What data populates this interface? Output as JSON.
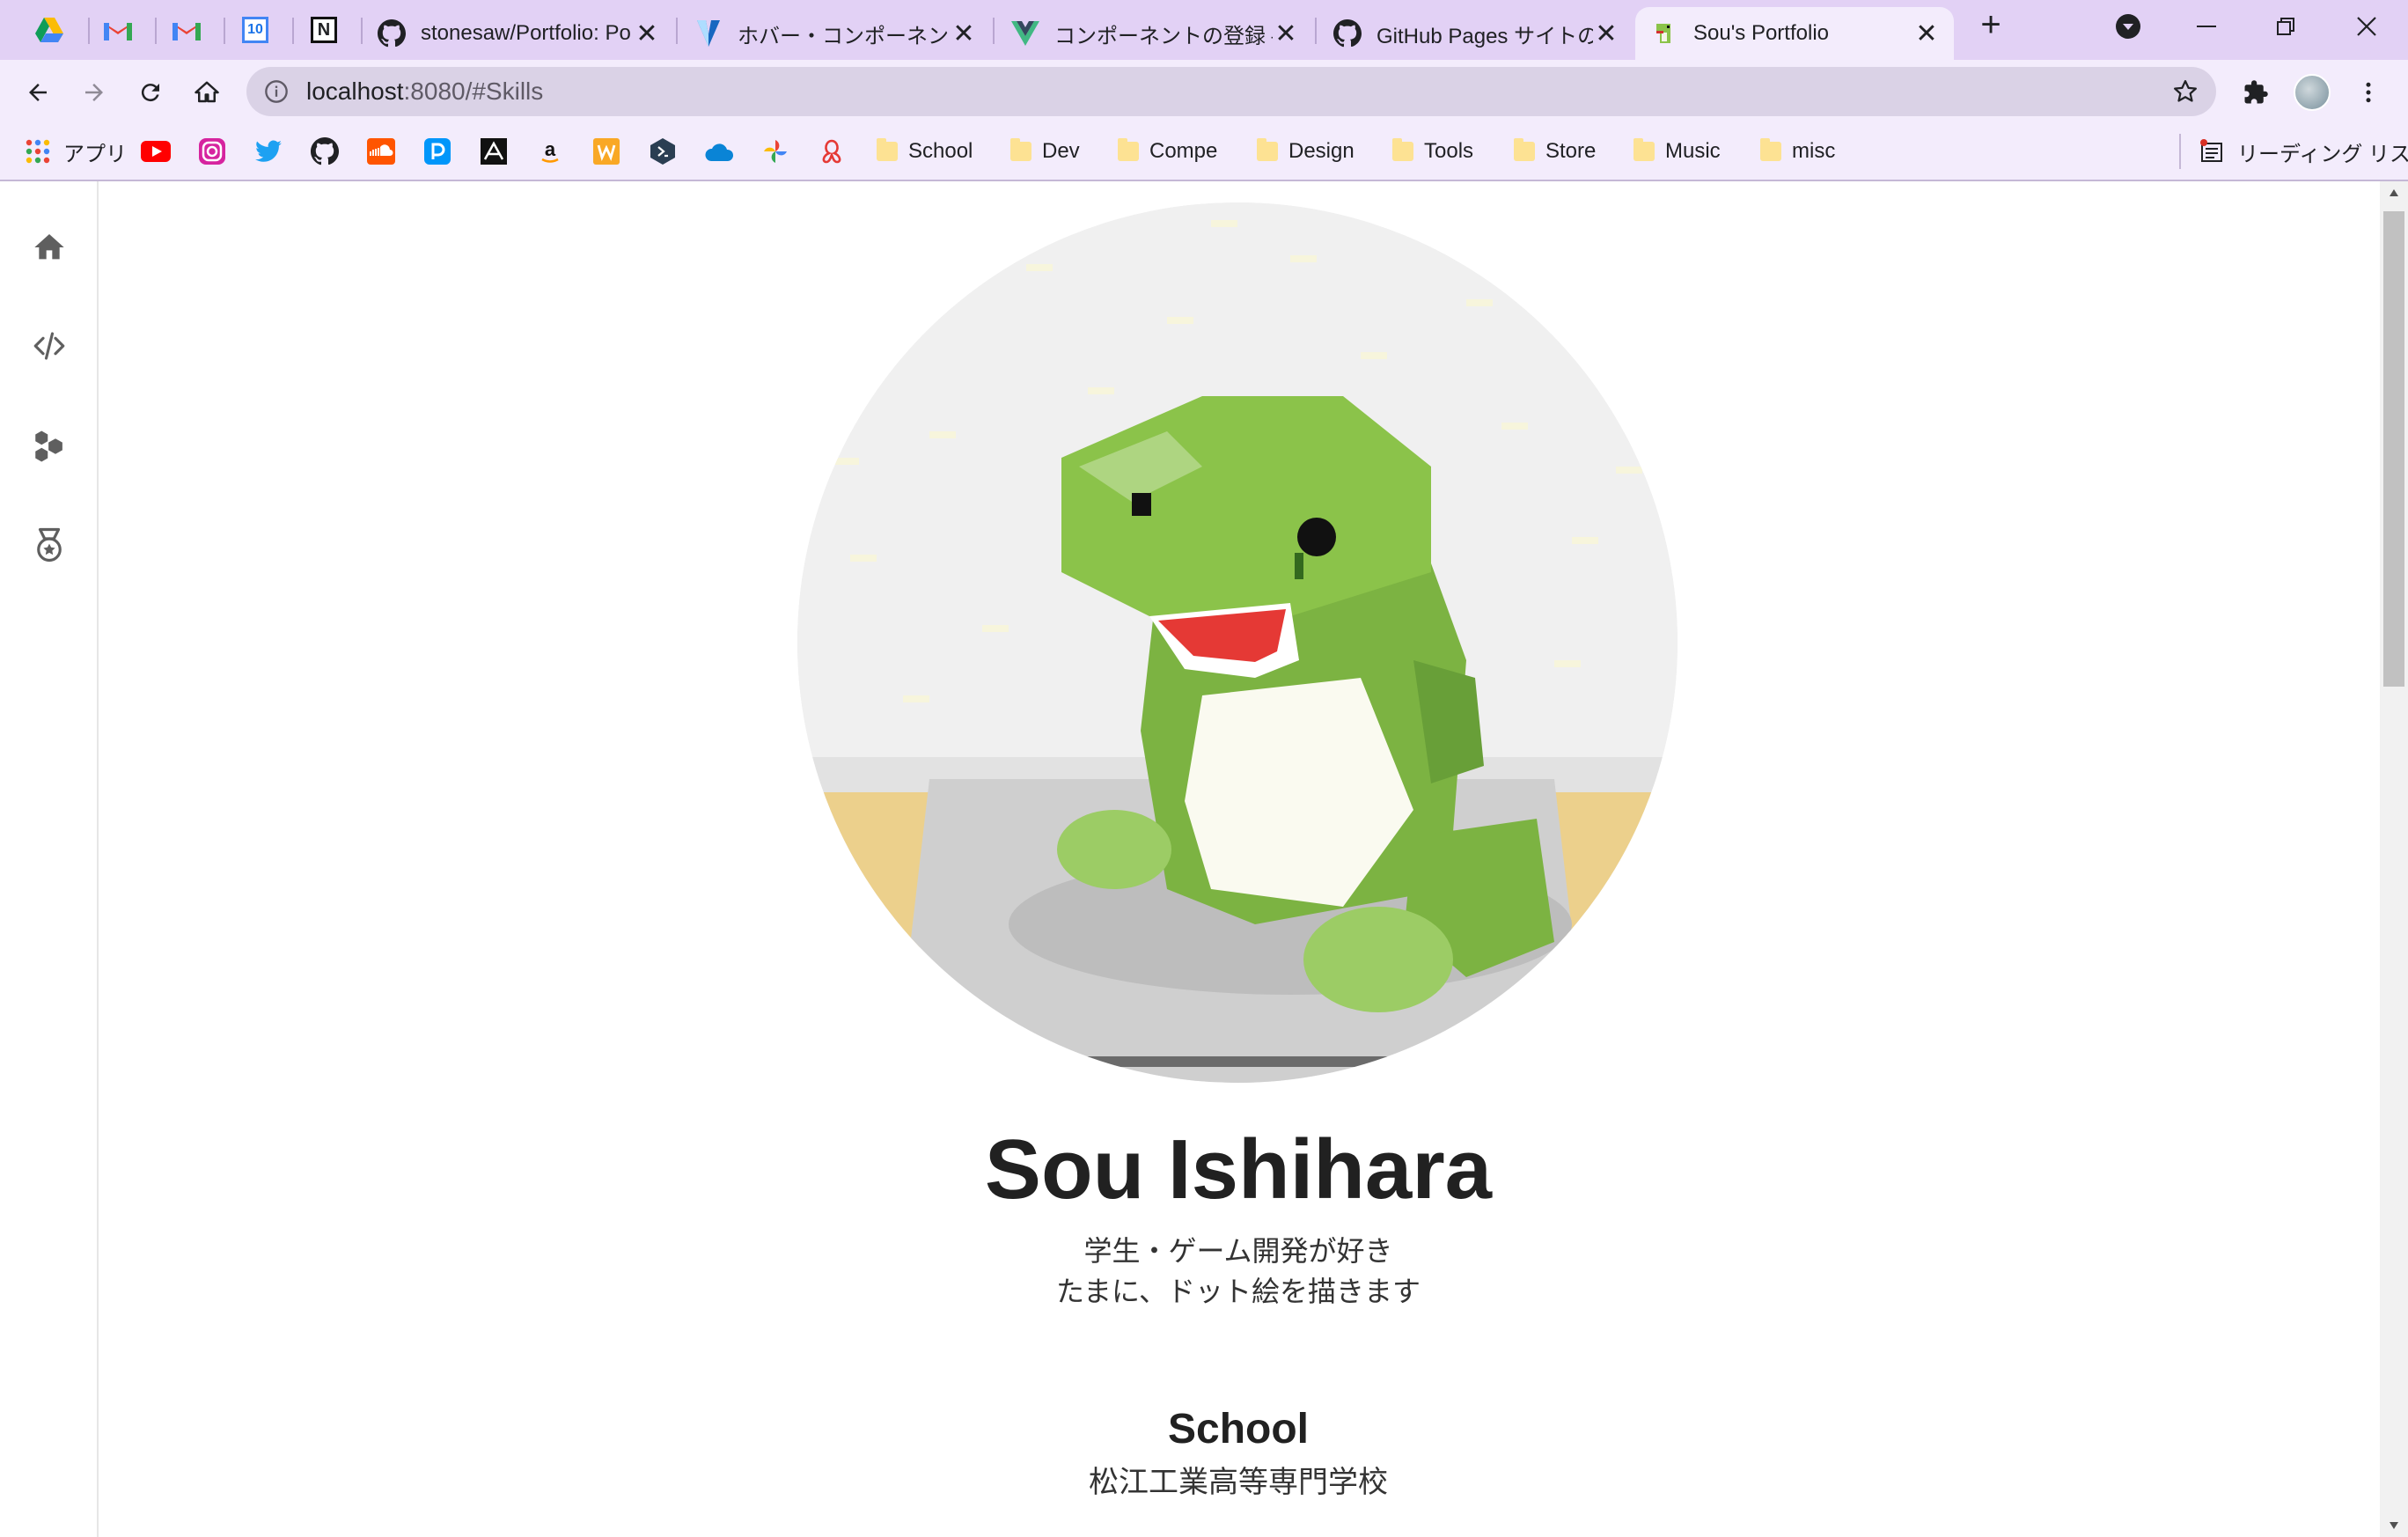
{
  "browser": {
    "tabs": [
      {
        "title": "stonesaw/Portfolio: Po",
        "icon": "github-icon"
      },
      {
        "title": "ホバー・コンポーネント — V",
        "icon": "vuetify-icon"
      },
      {
        "title": "コンポーネントの登録 — V",
        "icon": "vue-icon"
      },
      {
        "title": "GitHub Pages サイトの",
        "icon": "github-icon"
      },
      {
        "title": "Sou's Portfolio",
        "icon": "dino-icon",
        "active": true
      }
    ],
    "pinned_tabs": [
      "google-drive-icon",
      "gmail-icon",
      "gmail-icon",
      "google-calendar-icon",
      "notion-icon"
    ],
    "calendar_day": "10",
    "notion_letter": "N",
    "new_tab_label": "+",
    "close_label": "✕",
    "url_host": "localhost",
    "url_path": ":8080/#Skills",
    "bookmarks": {
      "apps_label": "アプリ",
      "folders": [
        "School",
        "Dev",
        "Compe",
        "Design",
        "Tools",
        "Store",
        "Music",
        "misc"
      ],
      "reading_list": "リーディング リスト",
      "site_icons": [
        "youtube-icon",
        "instagram-icon",
        "twitter-icon",
        "github-icon",
        "soundcloud-icon",
        "pixiv-icon",
        "atcoder-icon",
        "amazon-icon",
        "word-icon",
        "devtools-icon",
        "onedrive-icon",
        "photos-icon",
        "pdf-icon"
      ]
    }
  },
  "profile": {
    "name": "Sou Ishihara",
    "bio_line1": "学生・ゲーム開発が好き",
    "bio_line2": "たまに、ドット絵を描きます",
    "school_heading": "School",
    "school_name": "松江工業高等専門学校"
  },
  "colors": {
    "tabstrip": "#e2d1f5",
    "toolbar": "#f3ecfc",
    "omnibox": "#dad2e6",
    "dino_green": "#8bc34a"
  }
}
